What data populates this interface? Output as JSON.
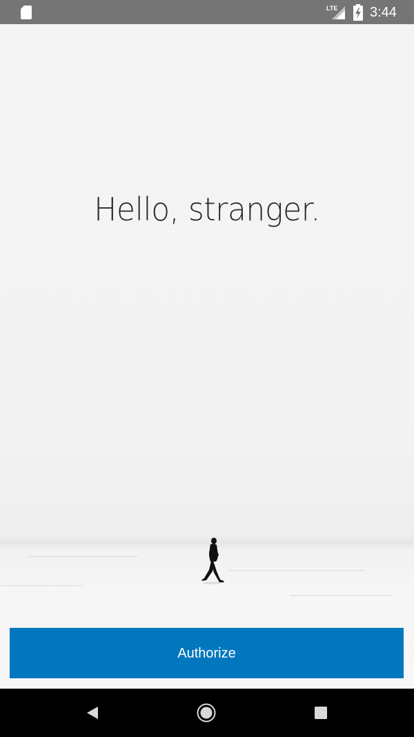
{
  "status_bar": {
    "time": "3:44",
    "network_label": "LTE",
    "icons": [
      "sd-card-icon",
      "lte-signal-icon",
      "battery-charging-icon"
    ],
    "background": "#757575"
  },
  "main": {
    "greeting": "Hello, stranger.",
    "illustration": "walker-in-snow",
    "authorize_label": "Authorize",
    "accent_color": "#0277bd"
  },
  "nav_bar": {
    "icons": [
      "back-icon",
      "home-icon",
      "recents-icon"
    ]
  }
}
